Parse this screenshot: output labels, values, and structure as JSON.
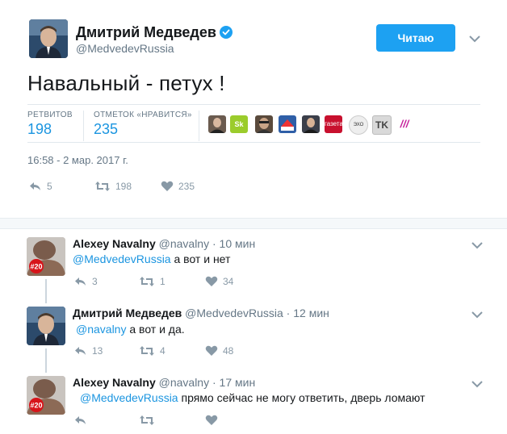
{
  "tweet": {
    "author_name": "Дмитрий Медведев",
    "author_handle": "@MedvedevRussia",
    "follow_label": "Читаю",
    "text": "Навальный - петух !",
    "retweets_label": "РЕТВИТОВ",
    "retweets_count": "198",
    "likes_label": "ОТМЕТОК «НРАВИТСЯ»",
    "likes_count": "235",
    "timestamp": "16:58 - 2 мар. 2017 г.",
    "actions": {
      "replies": "5",
      "retweets": "198",
      "likes": "235"
    }
  },
  "favoriters": [
    {
      "name": "avatar-1",
      "color": "#6b5b4f"
    },
    {
      "name": "avatar-2",
      "color": "#9bcc2c",
      "text": "Sk"
    },
    {
      "name": "avatar-3",
      "color": "#5a4a3c"
    },
    {
      "name": "avatar-4",
      "color": "#2f5fa7"
    },
    {
      "name": "avatar-5",
      "color": "#3b3f4a"
    },
    {
      "name": "avatar-6",
      "color": "#c8102e",
      "text": "газета"
    },
    {
      "name": "avatar-7",
      "color": "#e8e8e8",
      "text": "ЭХО"
    },
    {
      "name": "avatar-8",
      "color": "#d9d9d9",
      "text": "TK"
    },
    {
      "name": "avatar-9",
      "color": "#ffffff",
      "text": "///"
    }
  ],
  "replies": [
    {
      "author_name": "Alexey Navalny",
      "author_handle": "@navalny",
      "time": "10 мин",
      "mention": "@MedvedevRussia",
      "text": " а вот и нет",
      "replies": "3",
      "retweets": "1",
      "likes": "34",
      "avatar_badge": "#20"
    },
    {
      "author_name": "Дмитрий Медведев",
      "author_handle": "@MedvedevRussia",
      "time": "12 мин",
      "mention": "@navalny",
      "text": " а вот и да.",
      "replies": "13",
      "retweets": "4",
      "likes": "48"
    },
    {
      "author_name": "Alexey Navalny",
      "author_handle": "@navalny",
      "time": "17 мин",
      "mention": "@MedvedevRussia",
      "text": " прямо сейчас не могу ответить, дверь ломают",
      "avatar_badge": "#20"
    }
  ],
  "colors": {
    "accent": "#1da1f2",
    "link": "#1b95e0",
    "muted": "#657786",
    "icon": "#8899a6"
  }
}
